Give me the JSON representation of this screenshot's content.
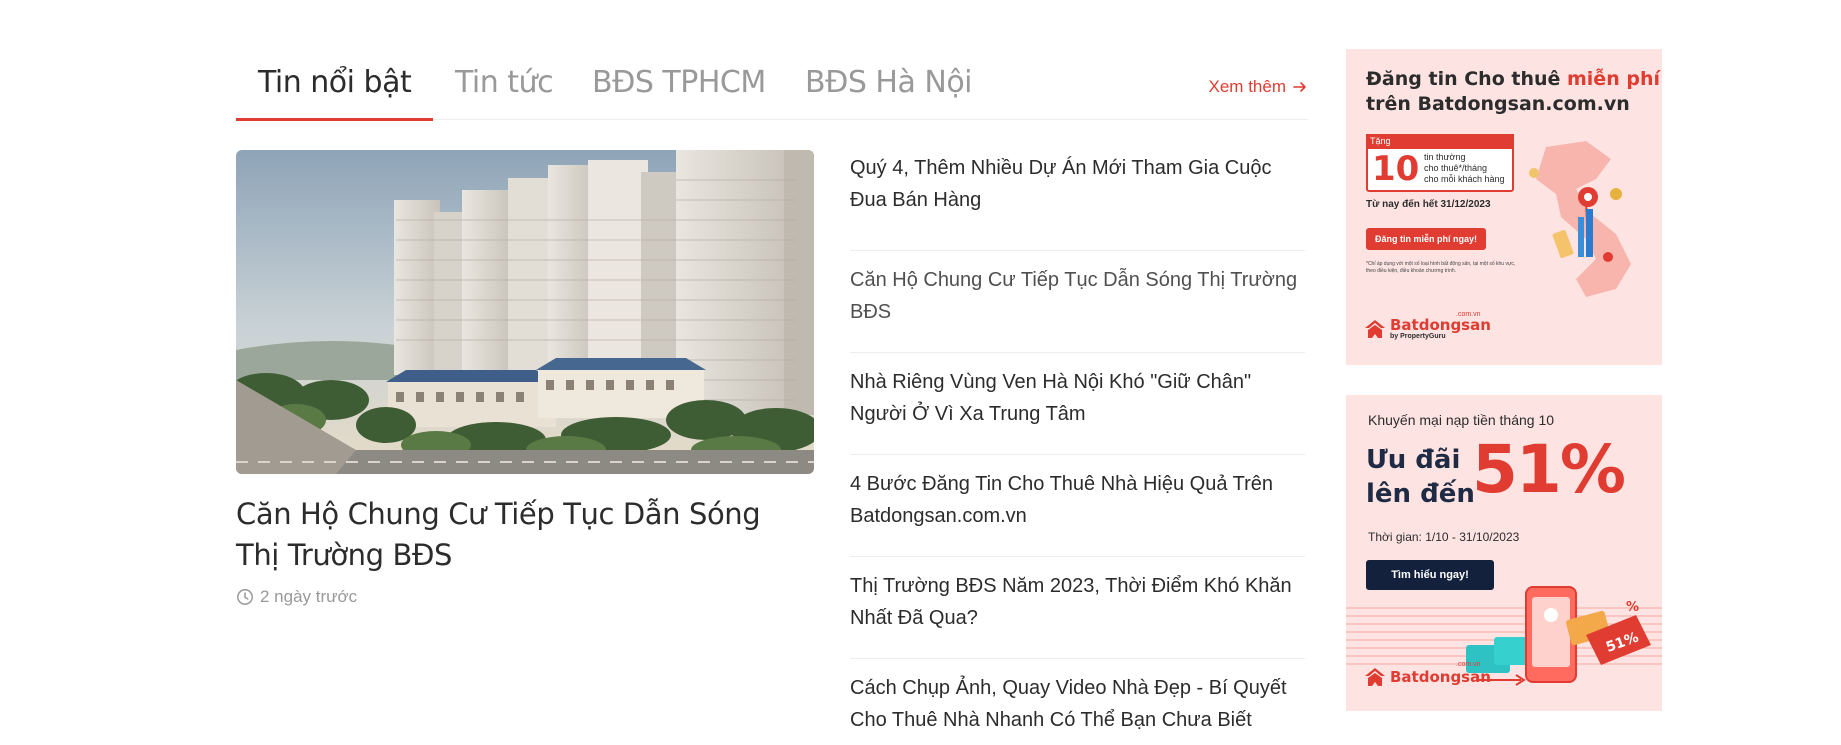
{
  "tabs": [
    {
      "label": "Tin nổi bật",
      "active": true
    },
    {
      "label": "Tin tức",
      "active": false
    },
    {
      "label": "BĐS TPHCM",
      "active": false
    },
    {
      "label": "BĐS Hà Nội",
      "active": false
    }
  ],
  "view_more": "Xem thêm",
  "featured": {
    "title": "Căn Hộ Chung Cư Tiếp Tục Dẫn Sóng Thị Trường BĐS",
    "time": "2 ngày trước"
  },
  "articles": [
    {
      "title": "Quý 4, Thêm Nhiều Dự Án Mới Tham Gia Cuộc Đua Bán Hàng"
    },
    {
      "title": "Căn Hộ Chung Cư Tiếp Tục Dẫn Sóng Thị Trường BĐS"
    },
    {
      "title": "Nhà Riêng Vùng Ven Hà Nội Khó \"Giữ Chân\" Người Ở Vì Xa Trung Tâm"
    },
    {
      "title": "4 Bước Đăng Tin Cho Thuê Nhà Hiệu Quả Trên Batdongsan.com.vn"
    },
    {
      "title": "Thị Trường BĐS Năm 2023, Thời Điểm Khó Khăn Nhất Đã Qua?"
    },
    {
      "title": "Cách Chụp Ảnh, Quay Video Nhà Đẹp - Bí Quyết Cho Thuê Nhà Nhanh Có Thể Bạn Chưa Biết"
    }
  ],
  "ad1": {
    "line1": "Đăng tin Cho thuê ",
    "line1_red": "miễn phí",
    "line2": "trên Batdongsan.com.vn",
    "tag": "Tặng",
    "count": "10",
    "count_desc_1": "tin thường",
    "count_desc_2": "cho thuê*/tháng",
    "count_desc_3": "cho mỗi khách hàng",
    "deadline": "Từ nay đến hết 31/12/2023",
    "cta": "Đăng tin miễn phí ngay!",
    "footnote": "*Chỉ áp dụng với một số loại hình bất động sản, tại một số khu vực, theo điều kiện, điều khoản chương trình.",
    "brand": "Batdongsan",
    "brand_domain": ".com.vn",
    "brand_sub": "by PropertyGuru"
  },
  "ad2": {
    "headline": "Khuyến mại nạp tiền tháng 10",
    "line1": "Ưu đãi",
    "line2": "lên đến",
    "percent": "51%",
    "period": "Thời gian: 1/10 - 31/10/2023",
    "cta": "Tìm hiểu ngay!",
    "badge": "51%",
    "badge_small": "%",
    "brand": "Batdongsan",
    "brand_domain": ".com.vn"
  },
  "colors": {
    "accent": "#e03c31",
    "ad_bg": "#fde4e2",
    "dark": "#2c2c2c",
    "muted": "#999999"
  }
}
